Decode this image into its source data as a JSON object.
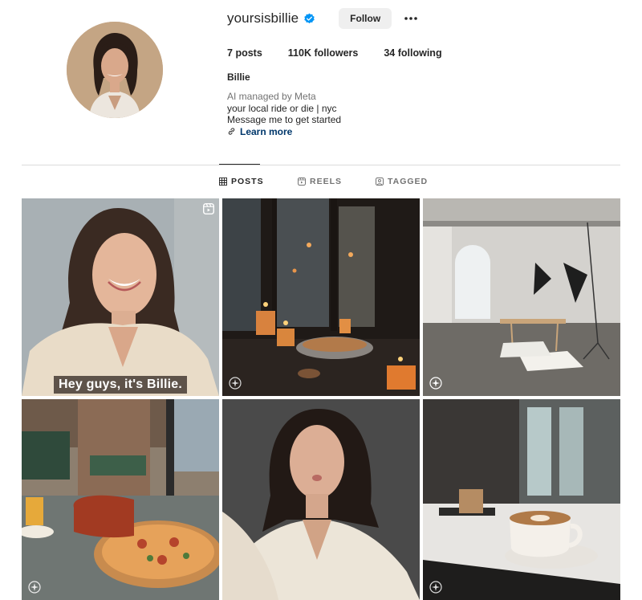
{
  "profile": {
    "username": "yoursisbillie",
    "follow_label": "Follow",
    "stats": {
      "posts_count": "7",
      "posts_label": "posts",
      "followers_count": "110K",
      "followers_label": "followers",
      "following_count": "34",
      "following_label": "following"
    },
    "full_name": "Billie",
    "bio": {
      "managed_by": "AI managed by Meta",
      "line1": "your local ride or die | nyc",
      "line2": "Message me to get started",
      "link_label": "Learn more"
    }
  },
  "tabs": [
    {
      "label": "POSTS",
      "icon": "grid-icon",
      "active": true
    },
    {
      "label": "REELS",
      "icon": "reels-icon",
      "active": false
    },
    {
      "label": "TAGGED",
      "icon": "tagged-icon",
      "active": false
    }
  ],
  "posts": [
    {
      "kind": "reel",
      "caption": "Hey guys, it's Billie."
    },
    {
      "kind": "photo",
      "description_icon": "ai-sparkle-icon"
    },
    {
      "kind": "photo",
      "description_icon": "ai-sparkle-icon"
    },
    {
      "kind": "photo",
      "description_icon": "ai-sparkle-icon"
    },
    {
      "kind": "photo"
    },
    {
      "kind": "photo",
      "description_icon": "ai-sparkle-icon"
    }
  ],
  "colors": {
    "verified": "#0095f6",
    "link": "#00376b",
    "follow_bg": "#efefef",
    "muted": "#737373"
  }
}
